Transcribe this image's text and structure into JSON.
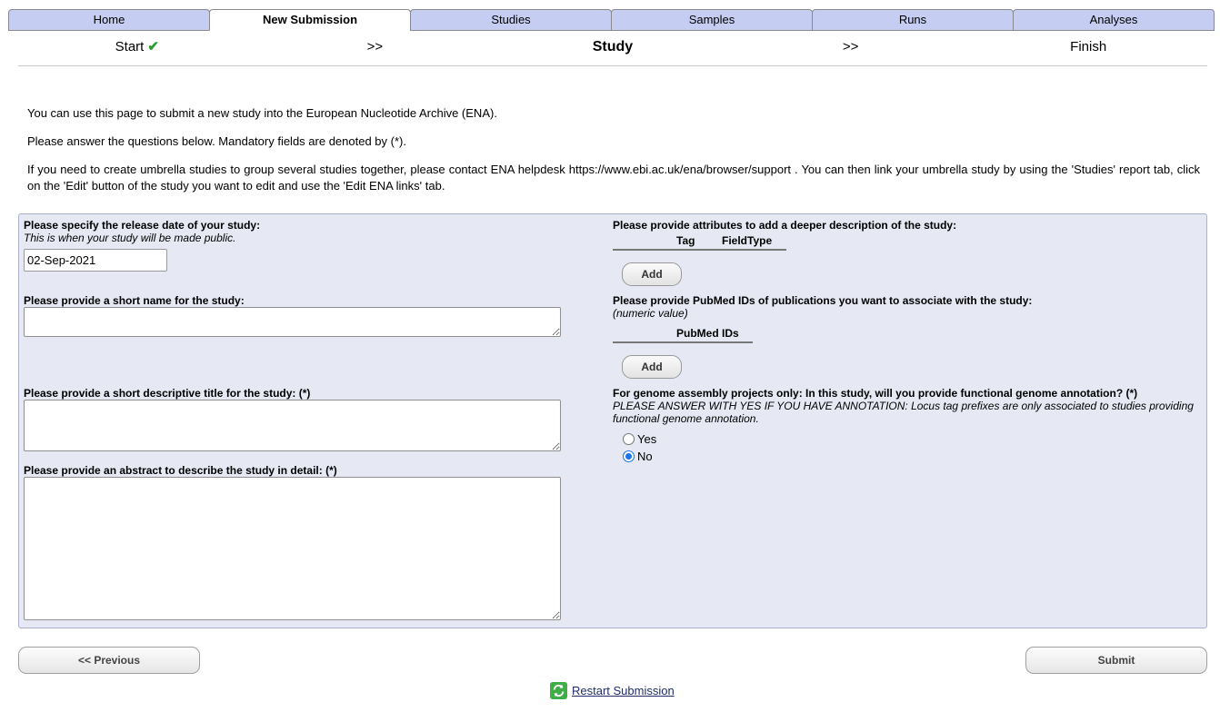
{
  "tabs": [
    {
      "label": "Home",
      "active": false
    },
    {
      "label": "New Submission",
      "active": true
    },
    {
      "label": "Studies",
      "active": false
    },
    {
      "label": "Samples",
      "active": false
    },
    {
      "label": "Runs",
      "active": false
    },
    {
      "label": "Analyses",
      "active": false
    }
  ],
  "steps": {
    "start": "Start",
    "sep1": ">>",
    "current": "Study",
    "sep2": ">>",
    "finish": "Finish"
  },
  "intro": {
    "line1": "You can use this page to submit a new study into the European Nucleotide Archive (ENA).",
    "line2": "Please answer the questions below. Mandatory fields are denoted by (*).",
    "line3": "If you need to create umbrella studies to group several studies together, please contact ENA helpdesk https://www.ebi.ac.uk/ena/browser/support . You can then link your umbrella study by using the 'Studies' report tab, click on the 'Edit' button of the study you want to edit and use the 'Edit ENA links' tab."
  },
  "form": {
    "release_date_label": "Please specify the release date of your study:",
    "release_date_hint": "This is when your study will be made public.",
    "release_date_value": "02-Sep-2021",
    "short_name_label": "Please provide a short name for the study:",
    "short_name_value": "",
    "title_label": "Please provide a short descriptive title for the study: (*)",
    "title_value": "",
    "abstract_label": "Please provide an abstract to describe the study in detail: (*)",
    "abstract_value": "",
    "attributes_label": "Please provide attributes to add a deeper description of the study:",
    "attributes_col_tag": "Tag",
    "attributes_col_fieldtype": "FieldType",
    "add_label": "Add",
    "pubmed_label": "Please provide PubMed IDs of publications you want to associate with the study:",
    "pubmed_hint": "(numeric value)",
    "pubmed_col": "PubMed IDs",
    "annotation_label": "For genome assembly projects only: In this study, will you provide functional genome annotation? (*)",
    "annotation_hint": "PLEASE ANSWER WITH YES IF YOU HAVE ANNOTATION: Locus tag prefixes are only associated to studies providing functional genome annotation.",
    "annotation_yes": "Yes",
    "annotation_no": "No",
    "annotation_selected": "No"
  },
  "footer": {
    "previous_label": "<< Previous",
    "submit_label": "Submit",
    "restart_label": "Restart Submission"
  },
  "colors": {
    "tab_bg": "#c5cdf2",
    "panel_bg": "#e6e9f4",
    "check_green": "#2a9d2a",
    "link": "#1f2d6e"
  },
  "icons": {
    "step_done": "check-icon",
    "restart": "refresh-icon"
  }
}
